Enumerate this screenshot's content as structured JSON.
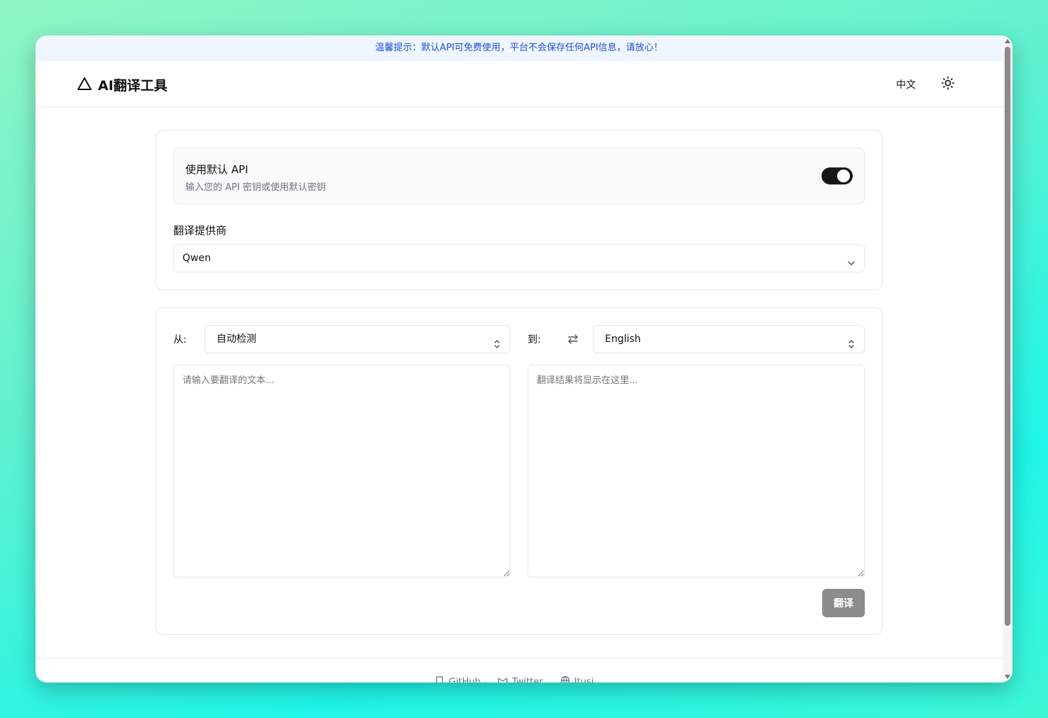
{
  "notice": {
    "text": "温馨提示：默认API可免费使用，平台不会保存任何API信息，请放心！"
  },
  "header": {
    "title": "AI翻译工具",
    "language": "中文",
    "logo_icon": "triangle-logo-icon",
    "theme_icon": "sun-icon"
  },
  "api_settings": {
    "title": "使用默认 API",
    "description": "输入您的 API 密钥或使用默认密钥",
    "enabled": true,
    "provider_label": "翻译提供商",
    "provider_value": "Qwen"
  },
  "translator": {
    "from_label": "从:",
    "from_value": "自动检测",
    "to_label": "到:",
    "to_value": "English",
    "source_placeholder": "请输入要翻译的文本...",
    "output_placeholder": "翻译结果将显示在这里...",
    "translate_label": "翻译"
  },
  "footer": {
    "links": [
      "GitHub",
      "Twitter",
      "Itusi"
    ]
  },
  "colors": {
    "notice_bg": "#eff6ff",
    "notice_text": "#1d4ed8",
    "toggle_on": "#171717",
    "button_disabled": "#8c8c8c"
  }
}
